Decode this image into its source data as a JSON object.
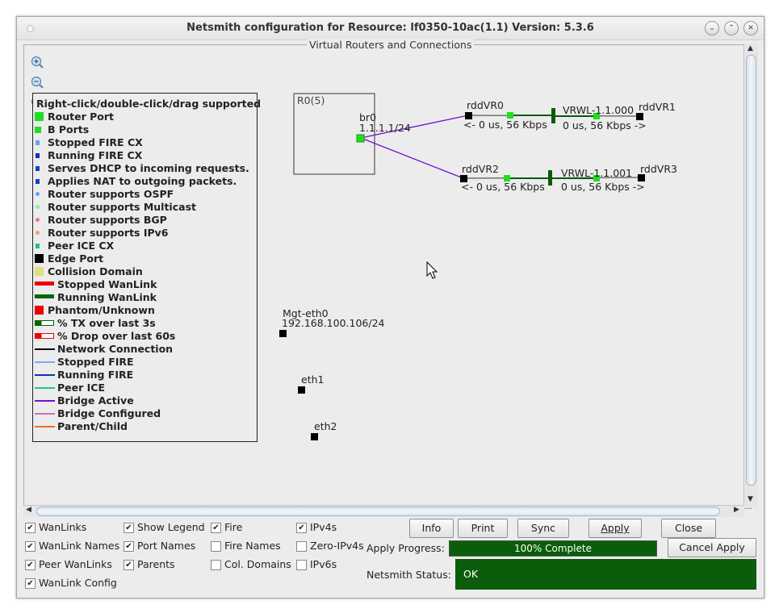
{
  "window": {
    "title": "Netsmith configuration for Resource:  lf0350-10ac(1.1)  Version: 5.3.6",
    "controls": [
      {
        "name": "minimize",
        "glyph": "⌄"
      },
      {
        "name": "maximize",
        "glyph": "⌃"
      },
      {
        "name": "close",
        "glyph": "✕"
      }
    ]
  },
  "panel": {
    "title": "Virtual Routers and Connections"
  },
  "zoom_controls": [
    {
      "name": "zoom-in-icon"
    },
    {
      "name": "zoom-out-icon"
    },
    {
      "name": "zoom-reset-icon"
    }
  ],
  "legend": {
    "header": "Right-click/double-click/drag supported",
    "items": [
      {
        "label": "Router Port",
        "swatch": "square-large",
        "color": "#22dd22"
      },
      {
        "label": "B Ports",
        "swatch": "square-small",
        "color": "#22dd22"
      },
      {
        "label": "Stopped FIRE CX",
        "swatch": "square-tiny",
        "color": "#6aa0f0"
      },
      {
        "label": "Running FIRE CX",
        "swatch": "square-tiny",
        "color": "#1030c0"
      },
      {
        "label": "Serves DHCP to incoming requests.",
        "swatch": "square-tiny",
        "color": "#1040d0"
      },
      {
        "label": "Applies NAT to outgoing packets.",
        "swatch": "square-tiny",
        "color": "#1040d0"
      },
      {
        "label": "Router supports OSPF",
        "swatch": "dot",
        "color": "#6a9ef0"
      },
      {
        "label": "Router supports Multicast",
        "swatch": "dot",
        "color": "#80f0b0"
      },
      {
        "label": "Router supports BGP",
        "swatch": "dot",
        "color": "#f07090"
      },
      {
        "label": "Router supports IPv6",
        "swatch": "dot",
        "color": "#f0a070"
      },
      {
        "label": "Peer ICE CX",
        "swatch": "square-tiny",
        "color": "#20c090"
      },
      {
        "label": "Edge Port",
        "swatch": "square-large",
        "color": "#000000"
      },
      {
        "label": "Collision Domain",
        "swatch": "square-large",
        "color": "#e0e080"
      },
      {
        "label": "Stopped WanLink",
        "swatch": "bar",
        "color": "#ee0000"
      },
      {
        "label": "Running WanLink",
        "swatch": "bar",
        "color": "#006600"
      },
      {
        "label": "Phantom/Unknown",
        "swatch": "square-large",
        "color": "#ee0000"
      },
      {
        "label": "% TX over last 3s",
        "swatch": "meter",
        "color": "#006600"
      },
      {
        "label": "% Drop over last 60s",
        "swatch": "meter",
        "color": "#ee0000"
      },
      {
        "label": "Network Connection",
        "swatch": "line",
        "color": "#000000"
      },
      {
        "label": "Stopped FIRE",
        "swatch": "line",
        "color": "#80a8f0"
      },
      {
        "label": "Running FIRE",
        "swatch": "line",
        "color": "#1030b0"
      },
      {
        "label": "Peer ICE",
        "swatch": "line",
        "color": "#20c0a0"
      },
      {
        "label": "Bridge Active",
        "swatch": "line",
        "color": "#7010d0"
      },
      {
        "label": "Bridge Configured",
        "swatch": "line",
        "color": "#d070b0"
      },
      {
        "label": "Parent/Child",
        "swatch": "line",
        "color": "#f07020"
      }
    ]
  },
  "topology": {
    "router": {
      "name": "R0(5)"
    },
    "bridge": {
      "name": "br0",
      "ip": "1.1.1.1/24"
    },
    "links": [
      {
        "left_port": "rddVR0",
        "wanlink": "VRWL-1.1.000",
        "right_port": "rddVR1",
        "left_stats": "<- 0 us, 56 Kbps",
        "right_stats": "0 us, 56 Kbps ->"
      },
      {
        "left_port": "rddVR2",
        "wanlink": "VRWL-1.1.001",
        "right_port": "rddVR3",
        "left_stats": "<- 0 us, 56 Kbps",
        "right_stats": "0 us, 56 Kbps ->"
      }
    ],
    "edge_ports": [
      {
        "name": "Mgt-eth0",
        "ip": "192.168.100.106/24"
      },
      {
        "name": "eth1",
        "ip": ""
      },
      {
        "name": "eth2",
        "ip": ""
      }
    ]
  },
  "options": {
    "checkboxes": [
      {
        "label": "WanLinks",
        "checked": true
      },
      {
        "label": "WanLink Names",
        "checked": true
      },
      {
        "label": "Peer WanLinks",
        "checked": true
      },
      {
        "label": "WanLink Config",
        "checked": true
      },
      {
        "label": "Show Legend",
        "checked": true
      },
      {
        "label": "Port Names",
        "checked": true
      },
      {
        "label": "Parents",
        "checked": true
      },
      {
        "label": "Fire",
        "checked": true
      },
      {
        "label": "Fire Names",
        "checked": false
      },
      {
        "label": "Col. Domains",
        "checked": false
      },
      {
        "label": "IPv4s",
        "checked": true
      },
      {
        "label": "Zero-IPv4s",
        "checked": false
      },
      {
        "label": "IPv6s",
        "checked": false
      }
    ]
  },
  "buttons": {
    "info": "Info",
    "print": "Print",
    "sync": "Sync",
    "apply": "Apply",
    "close": "Close",
    "cancel_apply": "Cancel Apply"
  },
  "apply_progress": {
    "label": "Apply Progress:",
    "value_percent": 100,
    "text": "100% Complete"
  },
  "netsmith_status": {
    "label": "Netsmith Status:",
    "value": "OK"
  },
  "colors": {
    "progress_fill": "#0b5d0b",
    "status_fill": "#0b5d0b",
    "bridge_line": "#7010d0",
    "port_green": "#22dd22",
    "wanlink_green": "#0a5a0a"
  }
}
